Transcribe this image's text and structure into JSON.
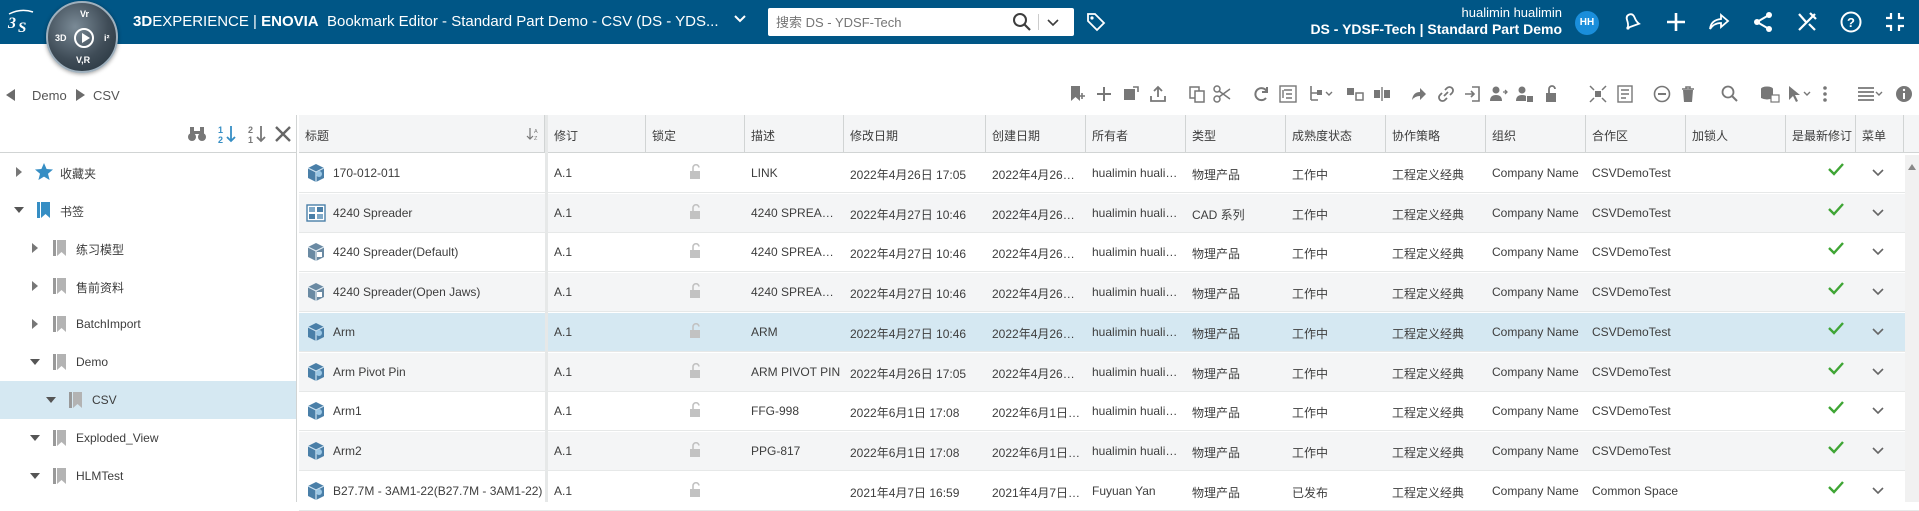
{
  "topbar": {
    "brand": "3DEXPERIENCE | ENOVIA",
    "brand_3d": "3D",
    "brand_exp": "EXPERIENCE",
    "brand_sep": " | ",
    "brand_app": "ENOVIA",
    "window_title": "Bookmark Editor - Standard Part Demo - CSV (DS - YDS...",
    "compass_labels": {
      "top": "Vr",
      "left": "3D",
      "right": "i²",
      "bottom": "V,R"
    },
    "search_placeholder": "搜索 DS - YDSF-Tech",
    "user_name": "hualimin hualimin",
    "tenant": "DS - YDSF-Tech | Standard Part Demo",
    "avatar_initials": "HH"
  },
  "breadcrumb": {
    "items": [
      "Demo",
      "CSV"
    ]
  },
  "tree": {
    "items": [
      {
        "label": "收藏夹",
        "level": 0,
        "expanded": false,
        "icon": "star-icon"
      },
      {
        "label": "书签",
        "level": 0,
        "expanded": true,
        "icon": "bookmark-icon"
      },
      {
        "label": "练习模型",
        "level": 1,
        "expanded": false,
        "icon": "bookmark-icon"
      },
      {
        "label": "售前资料",
        "level": 1,
        "expanded": false,
        "icon": "bookmark-icon"
      },
      {
        "label": "BatchImport",
        "level": 1,
        "expanded": false,
        "icon": "bookmark-icon"
      },
      {
        "label": "Demo",
        "level": 1,
        "expanded": true,
        "icon": "bookmark-icon"
      },
      {
        "label": "CSV",
        "level": 2,
        "expanded": true,
        "icon": "bookmark-icon",
        "selected": true
      },
      {
        "label": "Exploded_View",
        "level": 1,
        "expanded": true,
        "icon": "bookmark-icon"
      },
      {
        "label": "HLMTest",
        "level": 1,
        "expanded": true,
        "icon": "bookmark-icon"
      }
    ]
  },
  "columns": {
    "title": "标题",
    "revision": "修订",
    "lock": "锁定",
    "description": "描述",
    "modified": "修改日期",
    "created": "创建日期",
    "owner": "所有者",
    "type": "类型",
    "maturity": "成熟度状态",
    "policy": "协作策略",
    "organization": "组织",
    "collab_space": "合作区",
    "locker": "加锁人",
    "latest": "是最新修订",
    "menu": "菜单"
  },
  "rows": [
    {
      "title": "170-012-011",
      "rev": "A.1",
      "desc": "LINK",
      "modified": "2022年4月26日 17:05",
      "created": "2022年4月26…",
      "owner": "hualimin huali…",
      "type": "物理产品",
      "maturity": "工作中",
      "policy": "工程定义经典",
      "org": "Company Name",
      "space": "CSVDemoTest",
      "icon": "part-icon"
    },
    {
      "title": "4240 Spreader",
      "rev": "A.1",
      "desc": "4240 SPREA…",
      "modified": "2022年4月27日 10:46",
      "created": "2022年4月26…",
      "owner": "hualimin huali…",
      "type": "CAD 系列",
      "maturity": "工作中",
      "policy": "工程定义经典",
      "org": "Company Name",
      "space": "CSVDemoTest",
      "icon": "cad-family-icon"
    },
    {
      "title": "4240 Spreader(Default)",
      "rev": "A.1",
      "desc": "4240 SPREA…",
      "modified": "2022年4月27日 10:46",
      "created": "2022年4月26…",
      "owner": "hualimin huali…",
      "type": "物理产品",
      "maturity": "工作中",
      "policy": "工程定义经典",
      "org": "Company Name",
      "space": "CSVDemoTest",
      "icon": "product-icon"
    },
    {
      "title": "4240 Spreader(Open Jaws)",
      "rev": "A.1",
      "desc": "4240 SPREA…",
      "modified": "2022年4月27日 10:46",
      "created": "2022年4月26…",
      "owner": "hualimin huali…",
      "type": "物理产品",
      "maturity": "工作中",
      "policy": "工程定义经典",
      "org": "Company Name",
      "space": "CSVDemoTest",
      "icon": "product-icon"
    },
    {
      "title": "Arm",
      "rev": "A.1",
      "desc": "ARM",
      "modified": "2022年4月27日 10:46",
      "created": "2022年4月26…",
      "owner": "hualimin huali…",
      "type": "物理产品",
      "maturity": "工作中",
      "policy": "工程定义经典",
      "org": "Company Name",
      "space": "CSVDemoTest",
      "icon": "part-icon",
      "selected": true
    },
    {
      "title": "Arm Pivot Pin",
      "rev": "A.1",
      "desc": "ARM PIVOT PIN",
      "modified": "2022年4月26日 17:05",
      "created": "2022年4月26…",
      "owner": "hualimin huali…",
      "type": "物理产品",
      "maturity": "工作中",
      "policy": "工程定义经典",
      "org": "Company Name",
      "space": "CSVDemoTest",
      "icon": "part-icon"
    },
    {
      "title": "Arm1",
      "rev": "A.1",
      "desc": "FFG-998",
      "modified": "2022年6月1日 17:08",
      "created": "2022年6月1日…",
      "owner": "hualimin huali…",
      "type": "物理产品",
      "maturity": "工作中",
      "policy": "工程定义经典",
      "org": "Company Name",
      "space": "CSVDemoTest",
      "icon": "part-icon"
    },
    {
      "title": "Arm2",
      "rev": "A.1",
      "desc": "PPG-817",
      "modified": "2022年6月1日 17:08",
      "created": "2022年6月1日…",
      "owner": "hualimin huali…",
      "type": "物理产品",
      "maturity": "工作中",
      "policy": "工程定义经典",
      "org": "Company Name",
      "space": "CSVDemoTest",
      "icon": "part-icon"
    },
    {
      "title": "B27.7M - 3AM1-22(B27.7M - 3AM1-22)",
      "rev": "A.1",
      "desc": "",
      "modified": "2021年4月7日 16:59",
      "created": "2021年4月7日…",
      "owner": "Fuyuan Yan",
      "type": "物理产品",
      "maturity": "已发布",
      "policy": "工程定义经典",
      "org": "Company Name",
      "space": "Common Space",
      "icon": "part-icon"
    }
  ],
  "colors": {
    "topbar": "#005686",
    "selection": "#d5e8f2",
    "check": "#3fa535",
    "accent": "#368ec4"
  }
}
